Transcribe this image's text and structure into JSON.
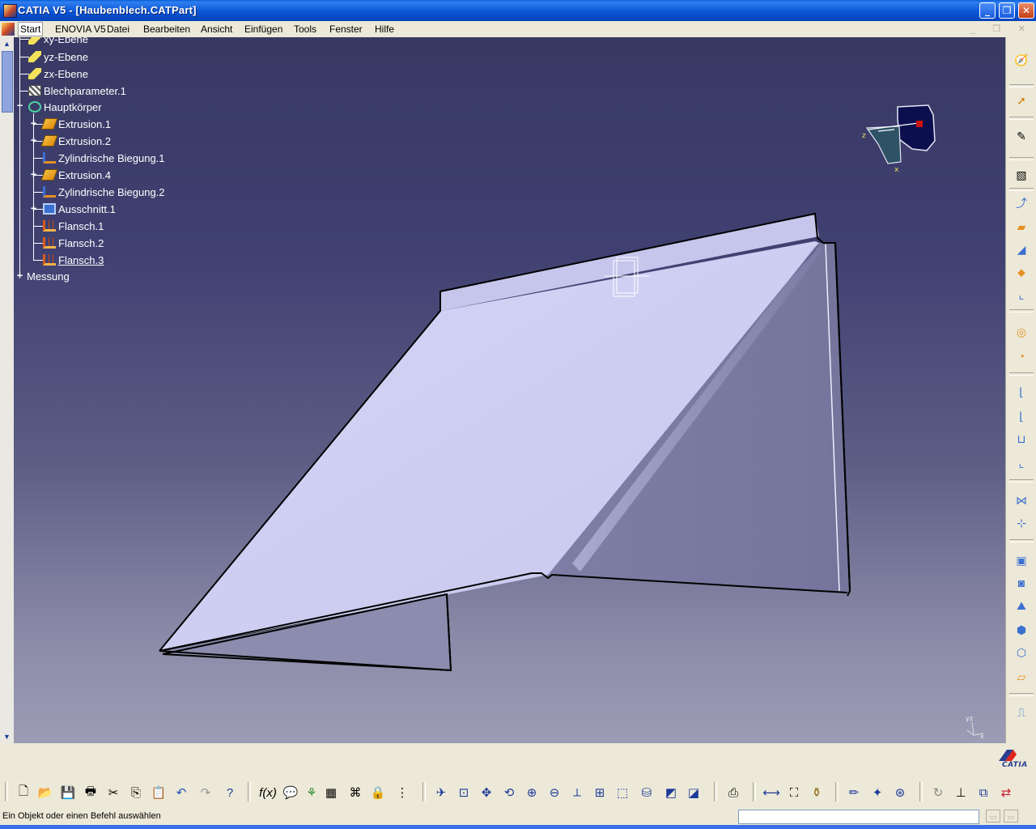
{
  "window": {
    "title": "CATIA V5 - [Haubenblech.CATPart]",
    "minimize_glyph": "_",
    "maximize_glyph": "❐",
    "close_glyph": "✕"
  },
  "menu": {
    "items": [
      "Start",
      "ENOVIA V5",
      "Datei",
      "Bearbeiten",
      "Ansicht",
      "Einfügen",
      "Tools",
      "Fenster",
      "Hilfe"
    ],
    "mdi_glyphs": "_ ❐ ✕"
  },
  "tree": {
    "nodes": [
      {
        "label": "xy-Ebene",
        "icon": "plane-icon"
      },
      {
        "label": "yz-Ebene",
        "icon": "plane-icon"
      },
      {
        "label": "zx-Ebene",
        "icon": "plane-icon"
      },
      {
        "label": "Blechparameter.1",
        "icon": "sheetmetal-parameters-icon"
      },
      {
        "label": "Hauptkörper",
        "icon": "body-icon"
      },
      {
        "label": "Extrusion.1",
        "icon": "extrusion-icon"
      },
      {
        "label": "Extrusion.2",
        "icon": "extrusion-icon"
      },
      {
        "label": "Zylindrische Biegung.1",
        "icon": "cylindrical-bend-icon"
      },
      {
        "label": "Extrusion.4",
        "icon": "extrusion-icon"
      },
      {
        "label": "Zylindrische Biegung.2",
        "icon": "cylindrical-bend-icon"
      },
      {
        "label": "Ausschnitt.1",
        "icon": "cutout-icon"
      },
      {
        "label": "Flansch.1",
        "icon": "flange-icon"
      },
      {
        "label": "Flansch.2",
        "icon": "flange-icon"
      },
      {
        "label": "Flansch.3",
        "icon": "flange-icon"
      },
      {
        "label": "Messung",
        "icon": "none"
      }
    ]
  },
  "viewport": {
    "compass_axis_labels": [
      "z",
      "x"
    ],
    "axis_labels": [
      "y",
      "z",
      "x"
    ],
    "background_top": "#383963",
    "background_bottom": "#9d9cb6",
    "part_color": "#cdcdf2"
  },
  "branding": {
    "logo_text": "CATIA"
  },
  "status": {
    "message": "Ein Objekt oder einen Befehl auswählen"
  },
  "toolbar_right": [
    "compass-icon",
    "select-arrow-icon",
    "sketch-icon",
    "sheetmetal-parameters-icon",
    "walls-recognition-icon",
    "wall-icon",
    "wall-on-edge-icon",
    "extrusion-icon",
    "swept-walls-icon",
    "rolled-wall-icon",
    "hopper-icon",
    "bend-icon",
    "bend-from-flat-icon",
    "conical-bend-icon",
    "unfold-icon",
    "fold-icon",
    "point-mapping-icon",
    "cutout-icon",
    "hole-icon",
    "stamping-icon",
    "corner-relief-icon",
    "chamfer-icon",
    "pattern-icon",
    "save-as-dxf-icon"
  ],
  "toolbar_bottom": [
    "new-icon",
    "open-icon",
    "save-icon",
    "print-icon",
    "cut-icon",
    "copy-icon",
    "paste-icon",
    "undo-icon",
    "redo-icon",
    "whats-this-icon",
    "formula-icon",
    "comment-icon",
    "knowledge-icon",
    "table-icon",
    "graph-icon",
    "lock-icon",
    "tree-expand-icon",
    "fly-mode-icon",
    "fit-all-icon",
    "pan-icon",
    "rotate-icon",
    "zoom-in-icon",
    "zoom-out-icon",
    "normal-view-icon",
    "multi-view-icon",
    "iso-view-icon",
    "render-style-icon",
    "hide-show-icon",
    "swap-space-icon",
    "catalog-icon",
    "measure-between-icon",
    "measure-item-icon",
    "measure-inertia-icon",
    "sketch-analysis-icon",
    "apply-material-icon",
    "sheet-analysis-icon",
    "update-icon",
    "axis-system-icon",
    "view-switch-icon",
    "mode-toggle-icon"
  ],
  "colors": {
    "titlebar": "#0a55d6",
    "chrome": "#ece9d8",
    "tree_text": "#ffffff"
  }
}
